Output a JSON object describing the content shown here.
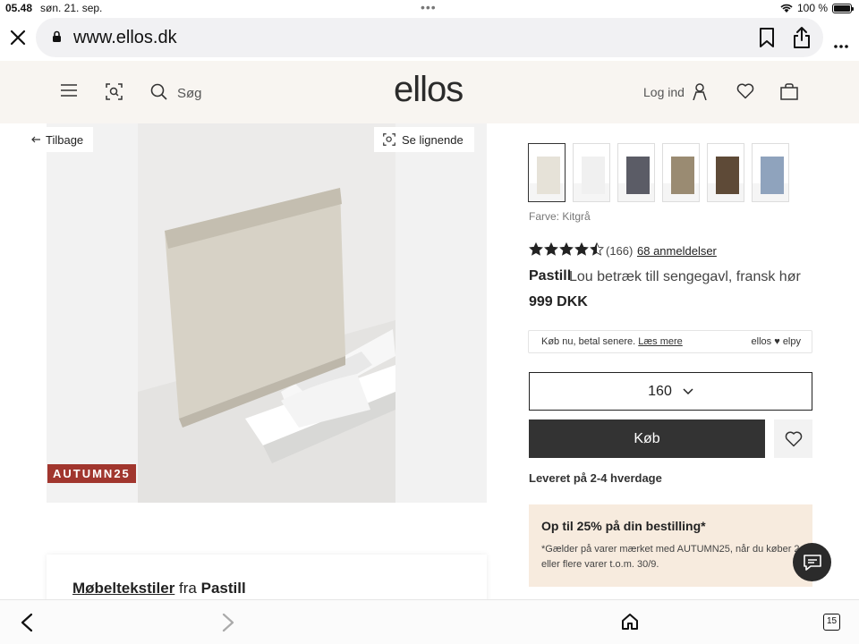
{
  "status": {
    "time": "05.48",
    "date": "søn. 21. sep.",
    "battery": "100 %",
    "battery_level": 1.0
  },
  "browser": {
    "url": "www.ellos.dk",
    "tab_count": "15"
  },
  "header": {
    "search_label": "Søg",
    "logo": "ellos",
    "login_label": "Log ind"
  },
  "gallery": {
    "back_label": "Tilbage",
    "similar_label": "Se lignende",
    "promo_tag": "AUTUMN25"
  },
  "product": {
    "color_label": "Farve: Kitgrå",
    "swatches": [
      "#e6e2d8",
      "#f0f0f0",
      "#5b5c66",
      "#9a8b72",
      "#5e4a37",
      "#8fa3bd"
    ],
    "rating": 4.5,
    "rating_count": "(166)",
    "reviews_link": "68 anmeldelser",
    "brand": "Pastill",
    "name": "Lou betræk till sengegavl, fransk hør",
    "price": "999 DKK",
    "klarna_text": "Køb nu, betal senere.",
    "klarna_link": "Læs mere",
    "klarna_logo": "ellos ♥ elpy",
    "size": "160",
    "buy_label": "Køb",
    "delivery": "Leveret på 2-4 hverdage",
    "offer_title": "Op til 25% på din bestilling*",
    "offer_body": "*Gælder på varer mærket med AUTUMN25, når du køber 2 eller flere varer t.o.m. 30/9."
  },
  "category": {
    "link": "Møbeltekstiler",
    "connector": "fra",
    "brand": "Pastill"
  },
  "colors": {
    "dark": "#333333",
    "promo": "#a1362e",
    "offer_bg": "#f7ebde",
    "header_bg": "#f8f5f1"
  }
}
